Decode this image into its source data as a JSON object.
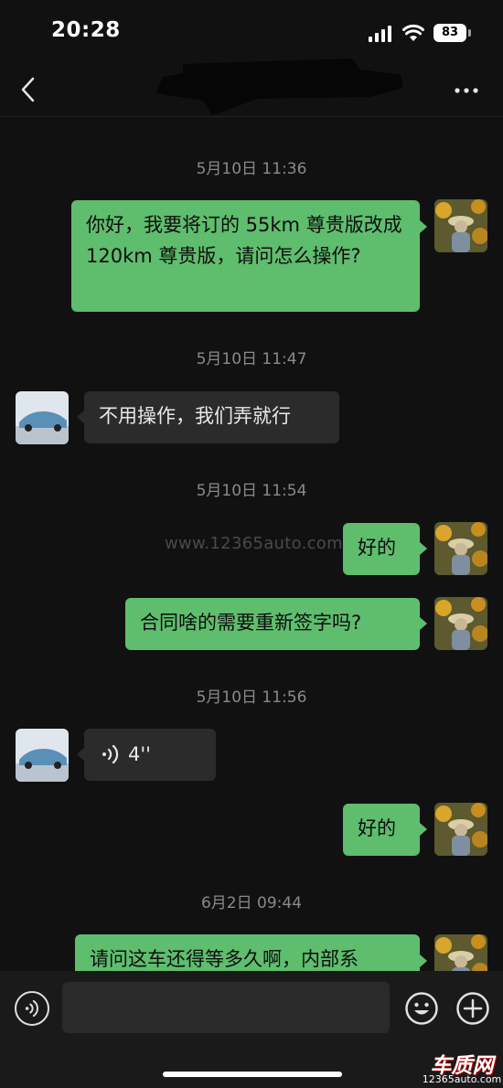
{
  "status_bar": {
    "time": "20:28",
    "battery": "83",
    "icons": [
      "signal-icon",
      "wifi-icon",
      "battery-icon"
    ]
  },
  "nav": {
    "back_icon": "chevron-left-icon",
    "more_icon": "more-dots-icon"
  },
  "chat": {
    "timestamps": [
      "5月10日 11:36",
      "5月10日 11:47",
      "5月10日 11:54",
      "5月10日 11:56",
      "6月2日 09:44"
    ],
    "messages": [
      {
        "sender": "me",
        "text": "你好，我要将订的 55km 尊贵版改成 120km 尊贵版，请问怎么操作?"
      },
      {
        "sender": "other",
        "text": "不用操作，我们弄就行"
      },
      {
        "sender": "me",
        "text": "好的"
      },
      {
        "sender": "me",
        "text": "合同啥的需要重新签字吗?"
      },
      {
        "sender": "other",
        "type": "voice",
        "duration": "4''"
      },
      {
        "sender": "me",
        "text": "好的"
      },
      {
        "sender": "me",
        "text": "请问这车还得等多久啊，内部系"
      }
    ],
    "watermark": "www.12365auto.com"
  },
  "input_bar": {
    "placeholder": "",
    "icons": [
      "voice-icon",
      "emoji-icon",
      "plus-icon"
    ]
  },
  "brand": {
    "name": "车质网",
    "url": "12365auto.com"
  },
  "colors": {
    "background": "#111111",
    "my_bubble": "#5fbd6e",
    "other_bubble": "#2b2b2b",
    "timestamp": "#8a8a8a"
  }
}
